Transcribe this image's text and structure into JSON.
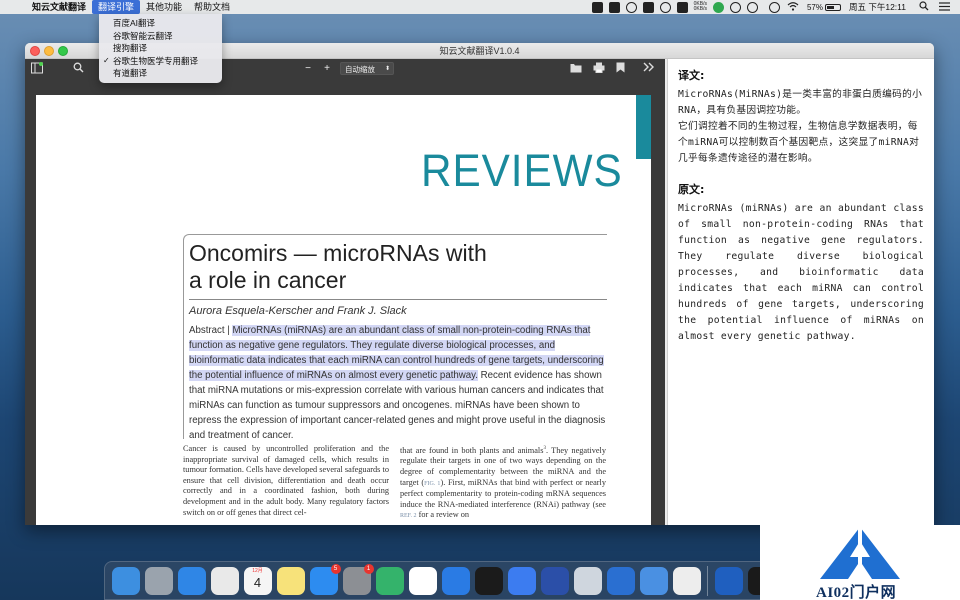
{
  "menubar": {
    "apple_icon": "apple-logo-icon",
    "items": [
      "知云文献翻译",
      "翻译引擎",
      "其他功能",
      "帮助文档"
    ],
    "active_item_index": 1,
    "tray_icons": [
      "record-icon",
      "grid-icon",
      "cloud-sync-icon",
      "tray-box-icon",
      "wechat-icon",
      "tray-doc-icon",
      "netspeed-icon",
      "wechat-green-icon",
      "vpn-icon",
      "360-icon",
      "time-machine-icon",
      "wifi-icon",
      "battery-icon",
      "search-icon",
      "menu-list-icon"
    ],
    "netspeed_up": "0KB/s",
    "netspeed_down": "0KB/s",
    "battery_percent": "57%",
    "battery_level": 0.57,
    "clock": "周五 下午12:11"
  },
  "engine_menu": {
    "items": [
      {
        "label": "百度AI翻译",
        "checked": false
      },
      {
        "label": "谷歌智能云翻译",
        "checked": false
      },
      {
        "label": "搜狗翻译",
        "checked": false
      },
      {
        "label": "谷歌生物医学专用翻译",
        "checked": true
      },
      {
        "label": "有道翻译",
        "checked": false
      }
    ],
    "check_glyph": "✓"
  },
  "window": {
    "title": "知云文献翻译V1.0.4"
  },
  "pdf_toolbar": {
    "zoom_out": "−",
    "zoom_in": "+",
    "zoom_mode": "自动缩放",
    "icons": [
      "sidebar-toggle-icon",
      "search-icon",
      "open-file-icon",
      "print-icon",
      "bookmark-icon",
      "more-tools-icon"
    ]
  },
  "paper": {
    "section": "REVIEWS",
    "title_line1": "Oncomirs — microRNAs with",
    "title_line2": "a role in cancer",
    "authors": "Aurora Esquela-Kerscher and Frank J. Slack",
    "abstract_label": "Abstract | ",
    "abstract_highlight": "MicroRNAs (miRNAs) are an abundant class of small non-protein-coding RNAs that function as negative gene regulators. They regulate diverse biological processes, and bioinformatic data indicates that each miRNA can control hundreds of gene targets, underscoring the potential influence of miRNAs on almost every genetic pathway.",
    "abstract_rest": " Recent evidence has shown that miRNA mutations or mis-expression correlate with various human cancers and indicates that miRNAs can function as tumour suppressors and oncogenes. miRNAs have been shown to repress the expression of important cancer-related genes and might prove useful in the diagnosis and treatment of cancer.",
    "col_left": "Cancer is caused by uncontrolled proliferation and the inappropriate survival of damaged cells, which results in tumour formation. Cells have developed several safeguards to ensure that cell division, differentiation and death occur correctly and in a coordinated fashion, both during development and in the adult body. Many regulatory factors switch on or off genes that direct cel-",
    "col_right_a": "that are found in both plants and animals",
    "col_right_sup": "3",
    "col_right_b": ". They negatively regulate their targets in one of two ways depending on the degree of complementarity between the miRNA and the target (",
    "col_right_fig": "FIG. 1",
    "col_right_c": "). First, miRNAs that bind with perfect or nearly perfect complementarity to protein-coding mRNA sequences induce the RNA-mediated interference (RNAi) pathway (see ",
    "col_right_ref": "REF. 2",
    "col_right_d": " for a review on"
  },
  "translation": {
    "translated_heading": "译文:",
    "translated_text": "MicroRNAs(MiRNAs)是一类丰富的非蛋白质编码的小RNA，具有负基因调控功能。\n它们调控着不同的生物过程，生物信息学数据表明，每个miRNA可以控制数百个基因靶点，这突显了miRNA对几乎每条遗传途径的潜在影响。",
    "original_heading": "原文:",
    "original_text": "MicroRNAs (miRNAs) are an abundant class of small non-protein-coding RNAs that function as negative gene regulators. They regulate diverse biological processes, and bioinformatic data indicates that each miRNA can control hundreds of gene targets, underscoring the potential influence of miRNAs on almost every genetic pathway."
  },
  "dock": {
    "apps": [
      {
        "name": "finder-icon",
        "color": "#3d8fe0"
      },
      {
        "name": "launchpad-icon",
        "color": "#9aa3ad"
      },
      {
        "name": "safari-icon",
        "color": "#2f86e6"
      },
      {
        "name": "chrome-icon",
        "color": "#e9e9e9"
      },
      {
        "name": "calendar-icon",
        "color": "#f5f5f5"
      },
      {
        "name": "notes-icon",
        "color": "#f7e27a"
      },
      {
        "name": "app-store-icon",
        "color": "#2d8cf0",
        "badge": "5"
      },
      {
        "name": "system-preferences-icon",
        "color": "#8c8f94",
        "badge": "1"
      },
      {
        "name": "play-icon",
        "color": "#34b36b"
      },
      {
        "name": "baidu-netdisk-icon",
        "color": "#ffffff"
      },
      {
        "name": "cloud-drive-icon",
        "color": "#2a7be4"
      },
      {
        "name": "xmind-icon",
        "color": "#1b1b1b"
      },
      {
        "name": "feishu-icon",
        "color": "#3c7cf0"
      },
      {
        "name": "zhiyun-icon",
        "color": "#2b4fa8"
      },
      {
        "name": "preview-icon",
        "color": "#cfd6de"
      },
      {
        "name": "boxes-icon",
        "color": "#2a6fd1"
      },
      {
        "name": "qq-icon",
        "color": "#4a90e2"
      },
      {
        "name": "textedit-icon",
        "color": "#ededed"
      },
      {
        "name": "shadowsocks-icon",
        "color": "#1f5fbf"
      },
      {
        "name": "pdf-reader-icon",
        "color": "#1a1a1a"
      }
    ],
    "separator_after": 17,
    "calendar_month": "12月",
    "calendar_day": "4"
  },
  "watermark": {
    "text": "AI02门户网",
    "logo_color": "#1f6fd1"
  }
}
